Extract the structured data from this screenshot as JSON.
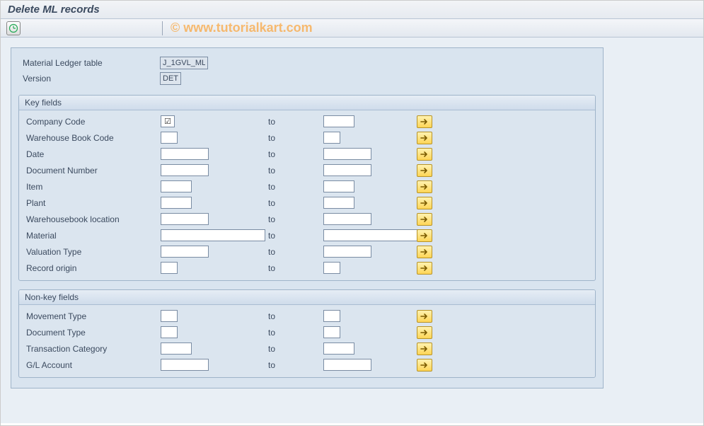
{
  "title": "Delete ML records",
  "watermark": "© www.tutorialkart.com",
  "top": {
    "ml_table_label": "Material Ledger table",
    "ml_table_value": "J_1GVL_ML",
    "version_label": "Version",
    "version_value": "DET"
  },
  "to_label": "to",
  "group_key": {
    "title": "Key fields",
    "rows": [
      {
        "label": "Company Code",
        "fw": "check",
        "tw": "w-s"
      },
      {
        "label": "Warehouse Book Code",
        "fw": "w-xs",
        "tw": "w-xs"
      },
      {
        "label": "Date",
        "fw": "w-m",
        "tw": "w-m"
      },
      {
        "label": "Document Number",
        "fw": "w-m",
        "tw": "w-m"
      },
      {
        "label": "Item",
        "fw": "w-s",
        "tw": "w-s"
      },
      {
        "label": "Plant",
        "fw": "w-s",
        "tw": "w-s"
      },
      {
        "label": "Warehousebook  location",
        "fw": "w-m",
        "tw": "w-m"
      },
      {
        "label": "Material",
        "fw": "w-xl",
        "tw": "w-xl"
      },
      {
        "label": "Valuation Type",
        "fw": "w-m",
        "tw": "w-m"
      },
      {
        "label": "Record origin",
        "fw": "w-xs",
        "tw": "w-xs"
      }
    ]
  },
  "group_nonkey": {
    "title": "Non-key fields",
    "rows": [
      {
        "label": "Movement Type",
        "fw": "w-xs",
        "tw": "w-xs"
      },
      {
        "label": "Document Type",
        "fw": "w-xs",
        "tw": "w-xs"
      },
      {
        "label": "Transaction Category",
        "fw": "w-s",
        "tw": "w-s"
      },
      {
        "label": "G/L Account",
        "fw": "w-m",
        "tw": "w-m"
      }
    ]
  }
}
